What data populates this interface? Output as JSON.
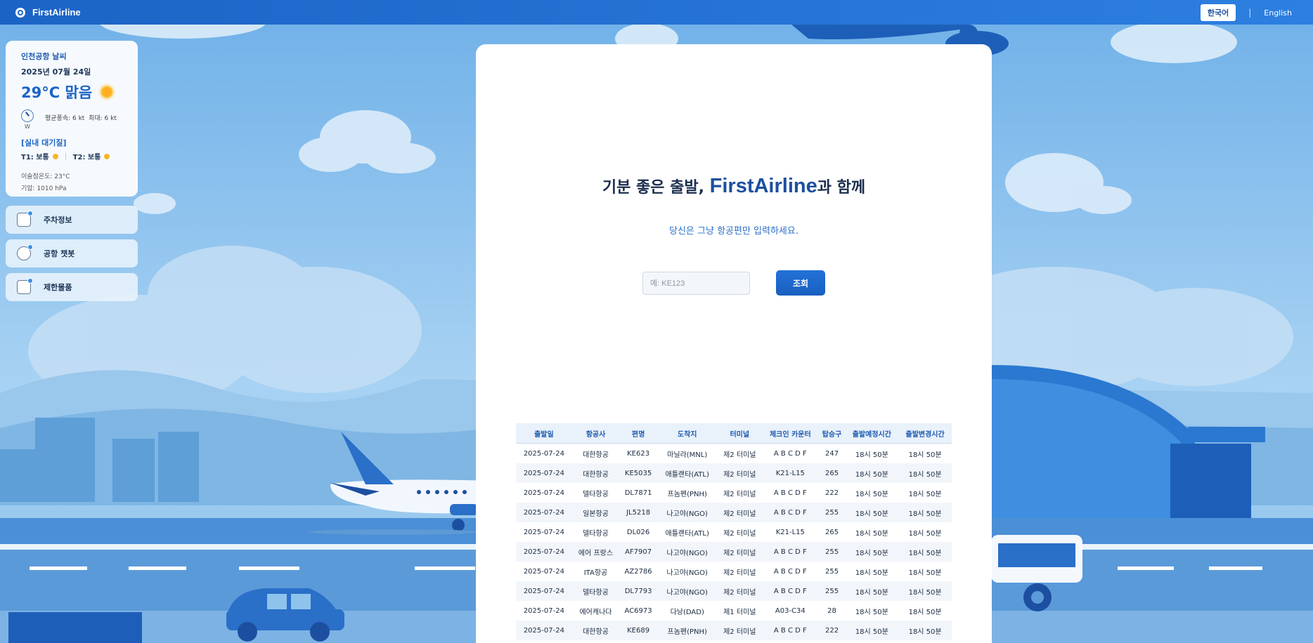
{
  "header": {
    "brand": "FirstAirline",
    "lang_ko": "한국어",
    "lang_sep": "|",
    "lang_en": "English"
  },
  "weather": {
    "title": "인천공항 날씨",
    "date": "2025년 07월 24일",
    "temp": "29°C 맑음",
    "wind_dir": "W",
    "wind": "평균풍속: 6 kt  최대: 6 kt",
    "air_title": "[실내 대기질]",
    "t1": "T1: 보통",
    "t2": "T2: 보통",
    "dew": "이슬점온도: 23°C",
    "pressure": "기압: 1010 hPa"
  },
  "sidebar": {
    "items": [
      {
        "label": "주차정보",
        "icon": "parking-icon"
      },
      {
        "label": "공항 챗봇",
        "icon": "chatbot-icon"
      },
      {
        "label": "제한물품",
        "icon": "restricted-items-icon"
      }
    ]
  },
  "main": {
    "headline_pre": "기분 좋은 출발, ",
    "headline_brand": "FirstAirline",
    "headline_post": "과 함께",
    "subline": "당신은 그냥 항공편만 입력하세요.",
    "search_placeholder": "예: KE123",
    "search_value": "",
    "search_button": "조회"
  },
  "table": {
    "headers": [
      "출발일",
      "항공사",
      "편명",
      "도착지",
      "터미널",
      "체크인 카운터",
      "탑승구",
      "출발예정시간",
      "출발변경시간"
    ],
    "rows": [
      [
        "2025-07-24",
        "대한항공",
        "KE623",
        "마닐라(MNL)",
        "제2 터미널",
        "A B C D F",
        "247",
        "18시 50분",
        "18시 50분"
      ],
      [
        "2025-07-24",
        "대한항공",
        "KE5035",
        "애틀랜타(ATL)",
        "제2 터미널",
        "K21-L15",
        "265",
        "18시 50분",
        "18시 50분"
      ],
      [
        "2025-07-24",
        "델타항공",
        "DL7871",
        "프놈펜(PNH)",
        "제2 터미널",
        "A B C D F",
        "222",
        "18시 50분",
        "18시 50분"
      ],
      [
        "2025-07-24",
        "일본항공",
        "JL5218",
        "나고야(NGO)",
        "제2 터미널",
        "A B C D F",
        "255",
        "18시 50분",
        "18시 50분"
      ],
      [
        "2025-07-24",
        "델타항공",
        "DL026",
        "애틀랜타(ATL)",
        "제2 터미널",
        "K21-L15",
        "265",
        "18시 50분",
        "18시 50분"
      ],
      [
        "2025-07-24",
        "에어 프랑스",
        "AF7907",
        "나고야(NGO)",
        "제2 터미널",
        "A B C D F",
        "255",
        "18시 50분",
        "18시 50분"
      ],
      [
        "2025-07-24",
        "ITA항공",
        "AZ2786",
        "나고야(NGO)",
        "제2 터미널",
        "A B C D F",
        "255",
        "18시 50분",
        "18시 50분"
      ],
      [
        "2025-07-24",
        "델타항공",
        "DL7793",
        "나고야(NGO)",
        "제2 터미널",
        "A B C D F",
        "255",
        "18시 50분",
        "18시 50분"
      ],
      [
        "2025-07-24",
        "에어캐나다",
        "AC6973",
        "다낭(DAD)",
        "제1 터미널",
        "A03-C34",
        "28",
        "18시 50분",
        "18시 50분"
      ],
      [
        "2025-07-24",
        "대한항공",
        "KE689",
        "프놈펜(PNH)",
        "제2 터미널",
        "A B C D F",
        "222",
        "18시 50분",
        "18시 50분"
      ]
    ]
  },
  "colors": {
    "topbar": "#1b64c6",
    "accent": "#1d4fa0",
    "sky": "#8ec3ec"
  }
}
